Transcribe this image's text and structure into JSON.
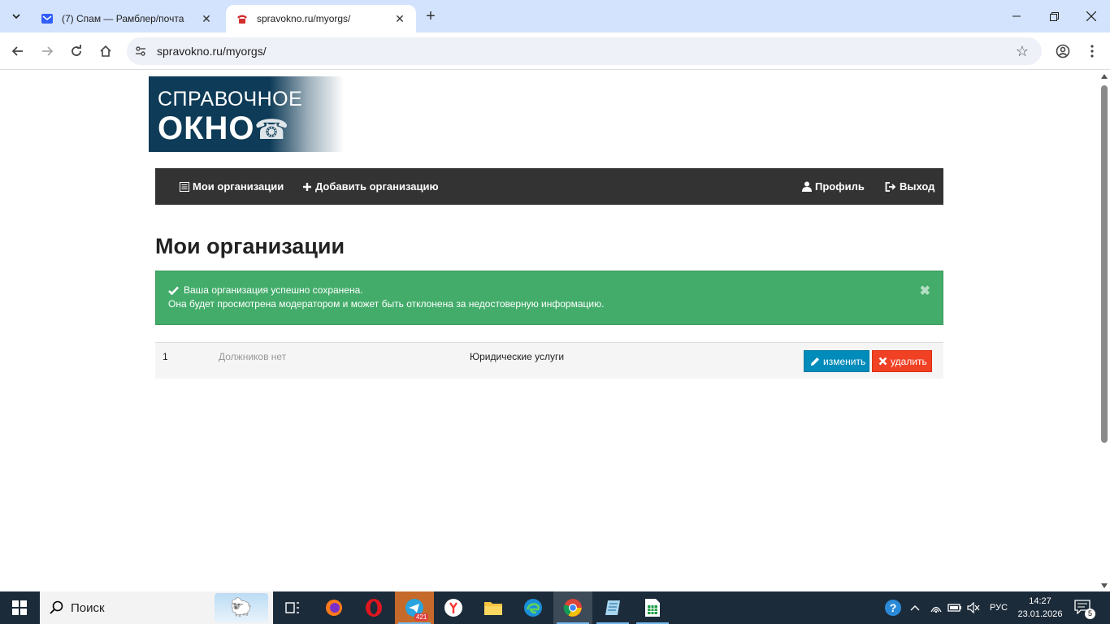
{
  "browser": {
    "tabs": [
      {
        "title": "(7) Спам — Рамблер/почта",
        "active": false
      },
      {
        "title": "spravokno.ru/myorgs/",
        "active": true
      }
    ],
    "url": "spravokno.ru/myorgs/"
  },
  "logo": {
    "line1": "СПРАВОЧНОЕ",
    "line2": "ОКНО"
  },
  "navbar": {
    "my_orgs": "Мои организации",
    "add_org": "Добавить организацию",
    "profile": "Профиль",
    "logout": "Выход"
  },
  "page": {
    "title": "Мои организации"
  },
  "alert": {
    "line1": "Ваша организация успешно сохранена.",
    "line2": "Она будет просмотрена модератором и может быть отклонена за недостоверную информацию.",
    "color": "#43ac6a"
  },
  "orgs": [
    {
      "num": "1",
      "debtors": "Должников нет",
      "category": "Юридические услуги",
      "edit_label": "изменить",
      "delete_label": "удалить"
    }
  ],
  "taskbar": {
    "search_placeholder": "Поиск",
    "telegram_badge": "421",
    "language": "РУС",
    "time": "14:27",
    "date": "23.01.2026",
    "notifications": "5"
  }
}
